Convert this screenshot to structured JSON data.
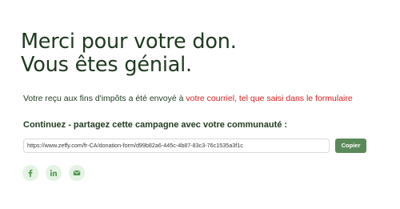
{
  "header": {
    "title_line1": "Merci pour votre don.",
    "title_line2": "Vous êtes génial."
  },
  "receipt": {
    "text": "Votre reçu aux fins d'impôts a été envoyé à ",
    "highlight": "votre courriel, tel que saisi dans le formulaire"
  },
  "share": {
    "heading": "Continuez - partagez cette campagne avec votre communauté :",
    "url": "https://www.zeffy.com/fr-CA/donation-form/d99b82a6-445c-4b87-83c3-76c1535a3f1c",
    "copy_label": "Copier",
    "icons": [
      "facebook-icon",
      "linkedin-icon",
      "email-icon"
    ]
  },
  "colors": {
    "text": "#1f3b1f",
    "highlight": "#d92020",
    "button": "#5a8a5a",
    "icon_bg": "#e4f3e4",
    "icon": "#4f9a4f"
  }
}
